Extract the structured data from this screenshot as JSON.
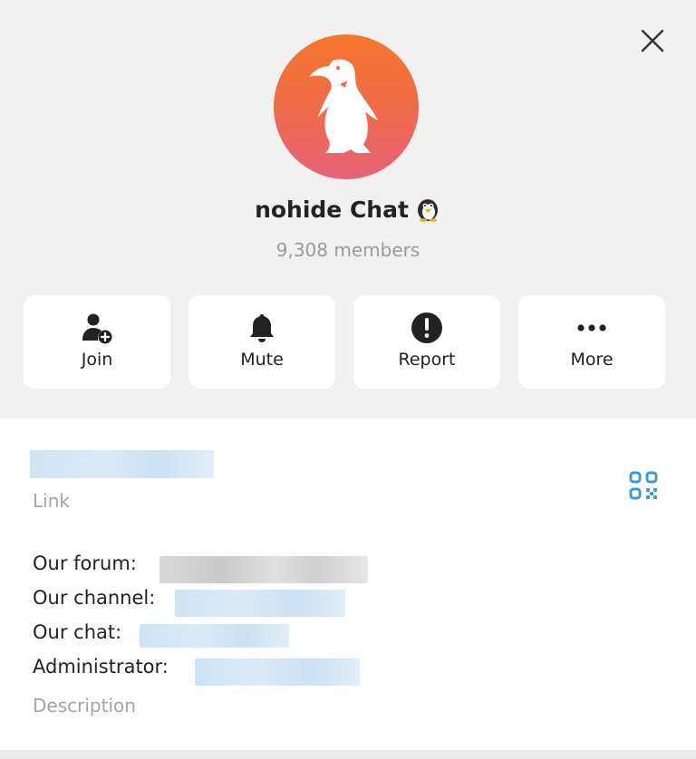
{
  "header": {
    "title": "nohide Chat",
    "subtitle": "9,308 members"
  },
  "actions": [
    {
      "label": "Join",
      "icon": "add-user-icon"
    },
    {
      "label": "Mute",
      "icon": "bell-icon"
    },
    {
      "label": "Report",
      "icon": "exclamation-icon"
    },
    {
      "label": "More",
      "icon": "more-dots-icon"
    }
  ],
  "info": {
    "link_label": "Link",
    "description_lines": {
      "forum": "Our forum:",
      "channel": "Our channel:",
      "chat": "Our chat:",
      "admin": "Administrator:"
    },
    "description_label": "Description"
  },
  "colors": {
    "accent": "#3a9ad9",
    "avatar_top": "#f4772c",
    "avatar_bottom": "#e8627a"
  }
}
